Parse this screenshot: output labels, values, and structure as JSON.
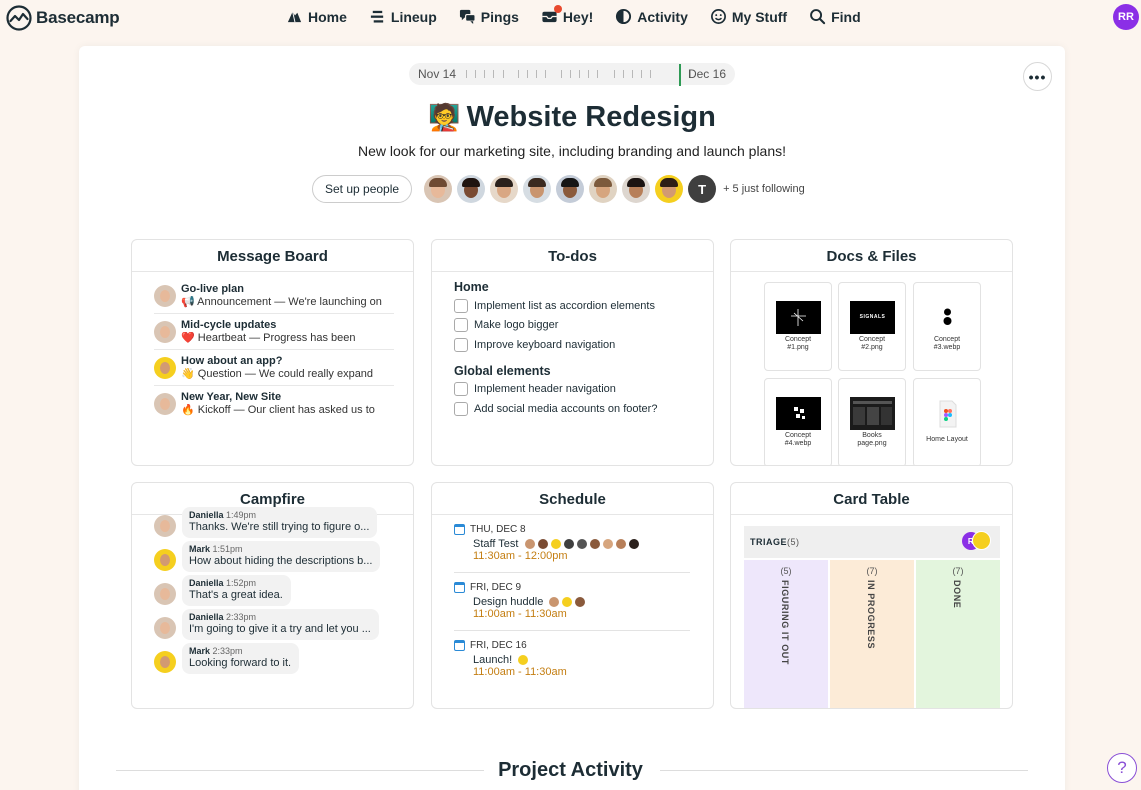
{
  "app": {
    "name": "Basecamp"
  },
  "nav": [
    {
      "label": "Home",
      "icon": "home-icon"
    },
    {
      "label": "Lineup",
      "icon": "lineup-icon"
    },
    {
      "label": "Pings",
      "icon": "pings-icon"
    },
    {
      "label": "Hey!",
      "icon": "hey-icon"
    },
    {
      "label": "Activity",
      "icon": "activity-icon"
    },
    {
      "label": "My Stuff",
      "icon": "my-stuff-icon"
    },
    {
      "label": "Find",
      "icon": "search-icon"
    }
  ],
  "user": {
    "initials": "RR",
    "color": "#8b2fe6"
  },
  "timeline": {
    "start": "Nov 14",
    "end": "Dec 16"
  },
  "project": {
    "emoji": "🧑‍🏫",
    "title": "Website Redesign",
    "description": "New look for our marketing site, including branding and launch plans!",
    "setup_people_label": "Set up people",
    "extra_avatar_initial": "T",
    "following": "+ 5 just following"
  },
  "message_board": {
    "title": "Message Board",
    "messages": [
      {
        "title": "Go-live plan",
        "emoji": "📢",
        "sub": "Announcement — We're launching on"
      },
      {
        "title": "Mid-cycle updates",
        "emoji": "❤️",
        "sub": "Heartbeat — Progress has been"
      },
      {
        "title": "How about an app?",
        "emoji": "👋",
        "sub": "Question — We could really expand"
      },
      {
        "title": "New Year, New Site",
        "emoji": "🔥",
        "sub": "Kickoff — Our client has asked us to"
      }
    ]
  },
  "todos": {
    "title": "To-dos",
    "groups": [
      {
        "name": "Home",
        "items": [
          "Implement list as accordion elements",
          "Make logo bigger",
          "Improve keyboard navigation"
        ]
      },
      {
        "name": "Global elements",
        "items": [
          "Implement header navigation",
          "Add social media accounts on footer?"
        ]
      }
    ]
  },
  "docs": {
    "title": "Docs & Files",
    "files": [
      {
        "name": "Concept #1.png",
        "line1": "Concept",
        "line2": "#1.png"
      },
      {
        "name": "Concept #2.png",
        "line1": "Concept",
        "line2": "#2.png"
      },
      {
        "name": "Concept #3.webp",
        "line1": "Concept",
        "line2": "#3.webp"
      },
      {
        "name": "Concept #4.webp",
        "line1": "Concept",
        "line2": "#4.webp"
      },
      {
        "name": "Books page.png",
        "line1": "Books",
        "line2": "page.png"
      },
      {
        "name": "Home Layout",
        "line1": "Home Layout",
        "line2": ""
      }
    ],
    "thumb_text_signals": "SIGNALS"
  },
  "campfire": {
    "title": "Campfire",
    "lines": [
      {
        "author": "Daniella",
        "time": "1:49pm",
        "text": "Thanks. We're still trying to figure o..."
      },
      {
        "author": "Mark",
        "time": "1:51pm",
        "text": "How about hiding the descriptions b..."
      },
      {
        "author": "Daniella",
        "time": "1:52pm",
        "text": "That's a great idea."
      },
      {
        "author": "Daniella",
        "time": "2:33pm",
        "text": "I'm going to give it a try and let you ..."
      },
      {
        "author": "Mark",
        "time": "2:33pm",
        "text": "Looking forward to it."
      }
    ]
  },
  "schedule": {
    "title": "Schedule",
    "events": [
      {
        "date": "THU, DEC 8",
        "title": "Staff Test",
        "time": "11:30am - 12:00pm",
        "attendees": 9
      },
      {
        "date": "FRI, DEC 9",
        "title": "Design huddle",
        "time": "11:00am - 11:30am",
        "attendees": 3
      },
      {
        "date": "FRI, DEC 16",
        "title": "Launch!",
        "time": "11:00am - 11:30am",
        "attendees": 1
      }
    ]
  },
  "card_table": {
    "title": "Card Table",
    "triage": {
      "label": "TRIAGE",
      "count": "(5)",
      "avatar_initials": "R"
    },
    "columns": [
      {
        "label": "FIGURING IT OUT",
        "count": "(5)",
        "color": "#eee7fb"
      },
      {
        "label": "IN PROGRESS",
        "count": "(7)",
        "color": "#fcebd7"
      },
      {
        "label": "DONE",
        "count": "(7)",
        "color": "#e3f5dd"
      }
    ]
  },
  "activity": {
    "title": "Project Activity"
  },
  "help": {
    "label": "?"
  }
}
